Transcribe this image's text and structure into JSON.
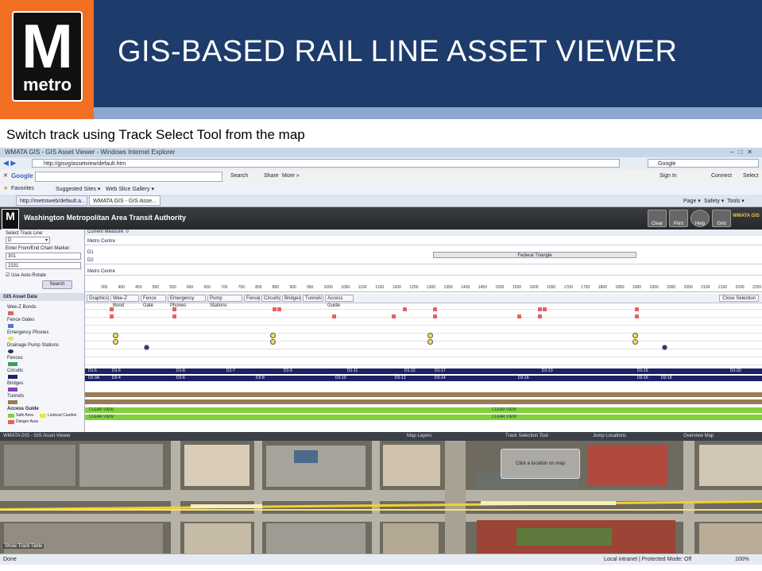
{
  "slide": {
    "title": "GIS-BASED RAIL LINE ASSET VIEWER",
    "caption": "Switch track using Track Select Tool from the map",
    "logo": {
      "letter": "M",
      "word": "metro"
    },
    "colors": {
      "header": "#1d3b6b",
      "logo_bg": "#f26e22",
      "subbar": "#8ea7d1"
    }
  },
  "browser": {
    "window_title": "WMATA GIS - GIS Asset Viewer - Windows Internet Explorer",
    "address": "http://gisvg/assetview/default.htm",
    "search_engine": "Google",
    "google_bar": {
      "label": "Google",
      "search": "Search",
      "share": "Share",
      "more": "More »",
      "sign_in": "Sign In",
      "connect": "Connect",
      "select": "Select"
    },
    "favorites": {
      "label": "Favorites",
      "suggested": "Suggested Sites ▾",
      "gallery": "Web Slice Gallery ▾"
    },
    "tabs": [
      "http://metroweb/default.a...",
      "WMATA GIS - GIS Asse..."
    ],
    "commands": {
      "page": "Page ▾",
      "safety": "Safety ▾",
      "tools": "Tools ▾"
    }
  },
  "app": {
    "logo_letter": "M",
    "title": "Washington Metropolitan Area Transit Authority",
    "badge": "WMATA GIS",
    "tools": [
      "Clear",
      "Print",
      "Help",
      "Grid"
    ]
  },
  "left_panel": {
    "track_line_label": "Select Track Line:",
    "track_line_value": "D",
    "marker_label": "Enter From/End Chain Marker:",
    "from_value": "301",
    "to_value": "2331",
    "auto_rotate": "Use Auto-Rotate",
    "search_button": "Search",
    "legend_title": "GIS Asset Data",
    "legend": [
      {
        "label": "Wee-Z Bonds",
        "color": "#e56060"
      },
      {
        "label": "Fence Gates",
        "color": "#5577cc"
      },
      {
        "label": "Emergency Phones",
        "color": "#f0e24a"
      },
      {
        "label": "Drainage Pump Stations",
        "color": "#335"
      },
      {
        "label": "Fences",
        "color": "#3c9f5a"
      },
      {
        "label": "Circuits",
        "color": "#1c2266"
      },
      {
        "label": "Bridges",
        "color": "#8b3fbf"
      },
      {
        "label": "Tunnels",
        "color": "#9b7a56"
      }
    ],
    "access_guide": {
      "title": "Access Guide",
      "safe": "Safe Area",
      "caution": "Lookout Caution",
      "danger": "Danger Area"
    }
  },
  "main_panel": {
    "current_measure": "Current Measure: 0",
    "segment1": "Metro Centre",
    "d1": "D1",
    "d2": "D2",
    "segment2": "Metro Centre",
    "federal_triangle": "Federal Triangle",
    "ruler": [
      "300",
      "400",
      "450",
      "500",
      "550",
      "600",
      "650",
      "700",
      "750",
      "800",
      "850",
      "900",
      "950",
      "1000",
      "1050",
      "1100",
      "1150",
      "1200",
      "1250",
      "1300",
      "1350",
      "1400",
      "1450",
      "1500",
      "1550",
      "1600",
      "1650",
      "1700",
      "1750",
      "1800",
      "1850",
      "1900",
      "1950",
      "2000",
      "2050",
      "2100",
      "2150",
      "2200",
      "2250"
    ],
    "subtabs": [
      "Graphics",
      "Wee-Z Bond",
      "Fence Gate",
      "Emergency Phones",
      "Pump Stations",
      "Fence",
      "Circuits",
      "Bridges",
      "Tunnels",
      "Access Guide"
    ],
    "close_selection": "Close Selection",
    "circuit_row1": [
      "D1-5",
      "D1-6",
      "D1-8",
      "D1-7",
      "D1-9",
      "D1-11",
      "D1-12",
      "D1-17",
      "D1-13",
      "D1-15",
      "D1-20"
    ],
    "circuit_row2": [
      "D2-3A",
      "D2-4",
      "D2-6",
      "D2-8",
      "D2-10",
      "D2-12",
      "D2-14",
      "D2-16",
      "D2-16",
      "D2-18"
    ],
    "access_row1": [
      "CLEAR VIEW",
      "CLEAR VIEW"
    ],
    "access_row2": [
      "CLEAR VIEW",
      "CLEAR VIEW"
    ]
  },
  "map": {
    "window_label": "WMATA GIS - GIS Asset Viewer",
    "layers": "Map Layers",
    "track_select": "Track Selection Tool",
    "locations": "Jump Locations",
    "overview": "Overview Map",
    "popup": "Click a location on map",
    "show_track_table": "Show Track Table"
  },
  "status": {
    "left": "Done",
    "zone": "Local intranet | Protected Mode: Off",
    "zoom": "100%"
  }
}
